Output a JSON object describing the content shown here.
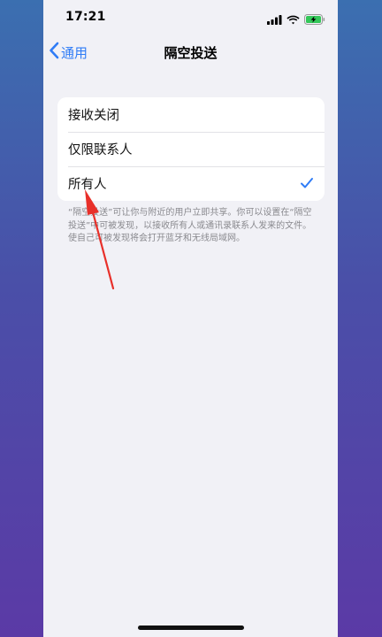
{
  "status_bar": {
    "time": "17:21",
    "icons": [
      "cellular-signal-icon",
      "wifi-icon",
      "battery-charging-icon"
    ]
  },
  "nav": {
    "back_label": "通用",
    "title": "隔空投送"
  },
  "options": [
    {
      "label": "接收关闭",
      "selected": false
    },
    {
      "label": "仅限联系人",
      "selected": false
    },
    {
      "label": "所有人",
      "selected": true
    }
  ],
  "footer": {
    "text": "“隔空投送”可让你与附近的用户立即共享。你可以设置在“隔空投送”中可被发现，以接收所有人或通讯录联系人发来的文件。使自己可被发现将会打开蓝牙和无线局域网。"
  },
  "colors": {
    "accent": "#2f7cf6",
    "annotation": "#e8302a"
  }
}
